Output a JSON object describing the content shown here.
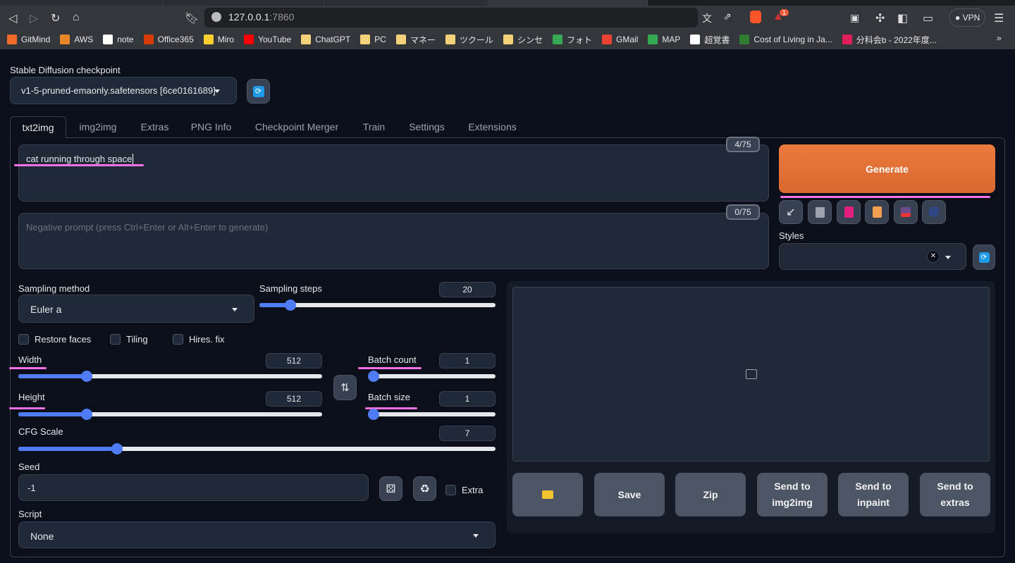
{
  "browser": {
    "url_host": "127.0.0.1",
    "url_port": ":7860",
    "vpn_label": "VPN",
    "notification_count": "1",
    "bookmarks": [
      {
        "label": "GitMind",
        "color": "#f06a2a"
      },
      {
        "label": "AWS",
        "color": "#e8872a"
      },
      {
        "label": "note",
        "color": "#ffffff"
      },
      {
        "label": "Office365",
        "color": "#d83b01"
      },
      {
        "label": "Miro",
        "color": "#ffd02f"
      },
      {
        "label": "YouTube",
        "color": "#ff0000"
      },
      {
        "label": "ChatGPT",
        "color": "#f4d27a"
      },
      {
        "label": "PC",
        "color": "#f4d27a"
      },
      {
        "label": "マネー",
        "color": "#f4d27a"
      },
      {
        "label": "ツクール",
        "color": "#f4d27a"
      },
      {
        "label": "シンセ",
        "color": "#f4d27a"
      },
      {
        "label": "フォト",
        "color": "#34a853"
      },
      {
        "label": "GMail",
        "color": "#ea4335"
      },
      {
        "label": "MAP",
        "color": "#34a853"
      },
      {
        "label": "超覚書",
        "color": "#ffffff"
      },
      {
        "label": "Cost of Living in Ja...",
        "color": "#2e7d32"
      },
      {
        "label": "分科会b - 2022年度...",
        "color": "#e01e5a"
      }
    ],
    "more": "»"
  },
  "checkpoint": {
    "label": "Stable Diffusion checkpoint",
    "value": "v1-5-pruned-emaonly.safetensors [6ce0161689]"
  },
  "tabs": [
    "txt2img",
    "img2img",
    "Extras",
    "PNG Info",
    "Checkpoint Merger",
    "Train",
    "Settings",
    "Extensions"
  ],
  "prompt": {
    "value": "cat running through space",
    "counter": "4/75"
  },
  "negative": {
    "placeholder": "Negative prompt (press Ctrl+Enter or Alt+Enter to generate)",
    "counter": "0/75"
  },
  "generate": {
    "label": "Generate",
    "color": "#e0713a"
  },
  "styles": {
    "label": "Styles",
    "clear": "✕"
  },
  "sampling": {
    "method_label": "Sampling method",
    "method": "Euler a",
    "steps_label": "Sampling steps",
    "steps": "20",
    "steps_fraction": 0.13
  },
  "checkboxes": {
    "restore_faces": "Restore faces",
    "tiling": "Tiling",
    "hires": "Hires. fix",
    "extra": "Extra"
  },
  "width": {
    "label": "Width",
    "value": "512",
    "fraction": 0.226
  },
  "height": {
    "label": "Height",
    "value": "512",
    "fraction": 0.226
  },
  "batch_count": {
    "label": "Batch count",
    "value": "1",
    "fraction": 0.0
  },
  "batch_size": {
    "label": "Batch size",
    "value": "1",
    "fraction": 0.0
  },
  "cfg": {
    "label": "CFG Scale",
    "value": "7",
    "fraction": 0.207
  },
  "seed": {
    "label": "Seed",
    "value": "-1"
  },
  "script": {
    "label": "Script",
    "value": "None"
  },
  "output_buttons": {
    "save": "Save",
    "zip": "Zip",
    "send_img2img": "Send to img2img",
    "send_inpaint": "Send to inpaint",
    "send_extras": "Send to extras"
  }
}
